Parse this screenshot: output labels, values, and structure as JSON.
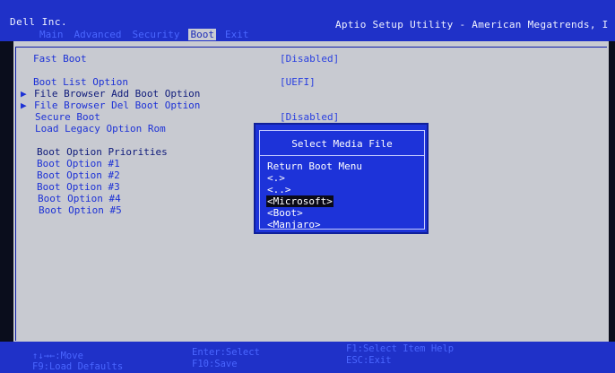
{
  "header": {
    "vendor": "Dell Inc.",
    "utility_title": "Aptio Setup Utility - American Megatrends, I",
    "tabs": [
      "Main",
      "Advanced",
      "Security",
      "Boot",
      "Exit"
    ],
    "active_tab": "Boot"
  },
  "settings": [
    {
      "label": "Fast Boot",
      "value": "[Disabled]"
    },
    {
      "label": "Boot List Option",
      "value": "[UEFI]"
    },
    {
      "label": "File Browser Add Boot Option",
      "submenu": true
    },
    {
      "label": "File Browser Del Boot Option",
      "submenu": true
    },
    {
      "label": "Secure Boot",
      "value": "[Disabled]"
    },
    {
      "label": "Load Legacy Option Rom"
    }
  ],
  "boot_priorities": {
    "heading": "Boot Option Priorities",
    "options": [
      "Boot Option #1",
      "Boot Option #2",
      "Boot Option #3",
      "Boot Option #4",
      "Boot Option #5"
    ]
  },
  "popup": {
    "title": "Select Media File",
    "items": [
      "Return Boot Menu",
      "<.>",
      "<..>",
      "<Microsoft>",
      "<Boot>",
      "<Manjaro>"
    ],
    "selected": "<Microsoft>"
  },
  "footer": {
    "move": "↑↓→←:Move",
    "load_defaults": "F9:Load Defaults",
    "enter": "Enter:Select",
    "save": "F10:Save",
    "help": "F1:Select Item Help",
    "exit": "ESC:Exit"
  },
  "colors": {
    "header_bg": "#1f31c8",
    "panel_bg": "#c8cad1",
    "popup_bg": "#1d33d9",
    "text_blue": "#1c31d6",
    "selected_bg": "#0a0a18"
  }
}
